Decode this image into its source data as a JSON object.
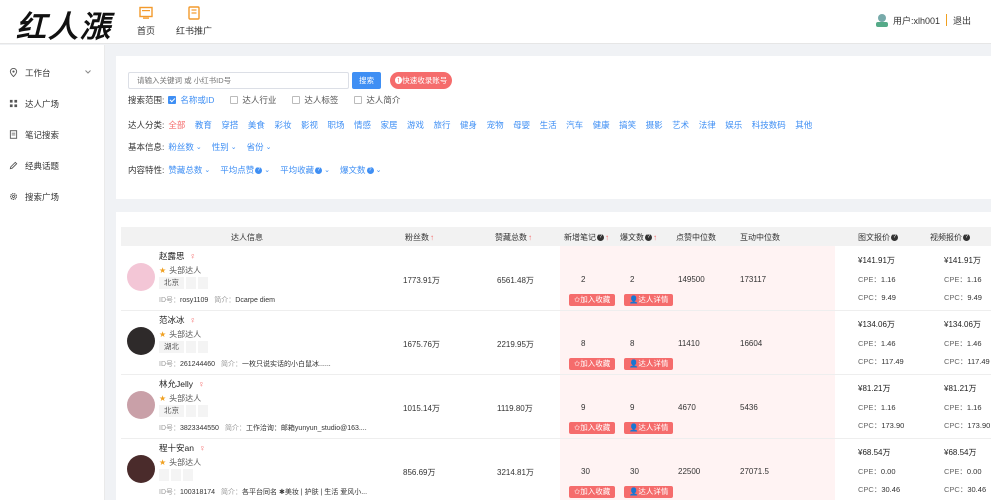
{
  "app": {
    "logo_text": "红人漲"
  },
  "topnav": [
    {
      "label": "首页"
    },
    {
      "label": "红书推广"
    }
  ],
  "user": {
    "label": "用户:xlh001",
    "logout": "退出"
  },
  "sidebar": {
    "items": [
      {
        "label": "工作台",
        "icon": "location-pin-icon"
      },
      {
        "label": "达人广场",
        "icon": "grid-icon"
      },
      {
        "label": "笔记搜索",
        "icon": "document-icon"
      },
      {
        "label": "经典话题",
        "icon": "edit-icon"
      },
      {
        "label": "搜索广场",
        "icon": "gear-icon"
      }
    ]
  },
  "search": {
    "placeholder": "请输入关键词 或 小红书ID号",
    "button": "搜索",
    "quick_button": "快速收录账号"
  },
  "filters": {
    "scope_label": "搜索范围:",
    "scope_options": [
      {
        "label": "名称或ID",
        "checked": true
      },
      {
        "label": "达人行业",
        "checked": false
      },
      {
        "label": "达人标签",
        "checked": false
      },
      {
        "label": "达人简介",
        "checked": false
      }
    ],
    "category_label": "达人分类:",
    "categories": [
      "全部",
      "教育",
      "穿搭",
      "美食",
      "彩妆",
      "影视",
      "职场",
      "情感",
      "家居",
      "游戏",
      "旅行",
      "健身",
      "宠物",
      "母婴",
      "生活",
      "汽车",
      "健康",
      "搞笑",
      "摄影",
      "艺术",
      "法律",
      "娱乐",
      "科技数码",
      "其他"
    ],
    "basic_label": "基本信息:",
    "basic_dropdowns": [
      "粉丝数",
      "性别",
      "省份"
    ],
    "content_label": "内容特性:",
    "content_dropdowns": [
      {
        "label": "赞藏总数",
        "help": false
      },
      {
        "label": "平均点赞",
        "help": true
      },
      {
        "label": "平均收藏",
        "help": true
      },
      {
        "label": "爆文数",
        "help": true
      }
    ]
  },
  "table": {
    "headers": {
      "info": "达人信息",
      "fans": "粉丝数",
      "likes_total": "赞藏总数",
      "new_notes": "新增笔记",
      "viral": "爆文数",
      "likes_median": "点赞中位数",
      "interact_median": "互动中位数",
      "image_price": "图文报价",
      "video_price": "视频报价"
    },
    "buttons": {
      "collect": "加入收藏",
      "detail": "达人详情"
    },
    "labels": {
      "tag": "头部达人",
      "id_prefix": "ID号：",
      "intro_prefix": "简介：",
      "cpe": "CPE：",
      "cpc": "CPC："
    },
    "rows": [
      {
        "name": "赵露思",
        "avatar_color": "#f3c6d6",
        "city": "北京",
        "id": "rosy1109",
        "intro": "Dcarpe diem",
        "fans": "1773.91万",
        "likes_total": "6561.48万",
        "new_notes": "2",
        "viral": "2",
        "likes_median": "149500",
        "interact_median": "173117",
        "image_price": "¥141.91万",
        "image_cpe": "1.16",
        "image_cpc": "9.49",
        "video_price": "¥141.91万",
        "video_cpe": "1.16",
        "video_cpc": "9.49"
      },
      {
        "name": "范冰冰",
        "avatar_color": "#2e2a2a",
        "city": "湖北",
        "id": "261244460",
        "intro": "一枚只说实话的小白鼠冰......",
        "fans": "1675.76万",
        "likes_total": "2219.95万",
        "new_notes": "8",
        "viral": "8",
        "likes_median": "11410",
        "interact_median": "16604",
        "image_price": "¥134.06万",
        "image_cpe": "1.46",
        "image_cpc": "117.49",
        "video_price": "¥134.06万",
        "video_cpe": "1.46",
        "video_cpc": "117.49"
      },
      {
        "name": "林允Jelly",
        "avatar_color": "#c9a0a8",
        "city": "北京",
        "id": "3823344550",
        "intro": "工作洽询：邮箱yunyun_studio@163....",
        "fans": "1015.14万",
        "likes_total": "1119.80万",
        "new_notes": "9",
        "viral": "9",
        "likes_median": "4670",
        "interact_median": "5436",
        "image_price": "¥81.21万",
        "image_cpe": "1.16",
        "image_cpc": "173.90",
        "video_price": "¥81.21万",
        "video_cpe": "1.16",
        "video_cpc": "173.90"
      },
      {
        "name": "程十安an",
        "avatar_color": "#4a2b2b",
        "city": "",
        "id": "100318174",
        "intro": "各平台同名 ✱美妆 | 护肤 | 生活 爱风小...",
        "fans": "856.69万",
        "likes_total": "3214.81万",
        "new_notes": "30",
        "viral": "30",
        "likes_median": "22500",
        "interact_median": "27071.5",
        "image_price": "¥68.54万",
        "image_cpe": "0.00",
        "image_cpc": "30.46",
        "video_price": "¥68.54万",
        "video_cpe": "0.00",
        "video_cpc": "30.46"
      }
    ]
  }
}
